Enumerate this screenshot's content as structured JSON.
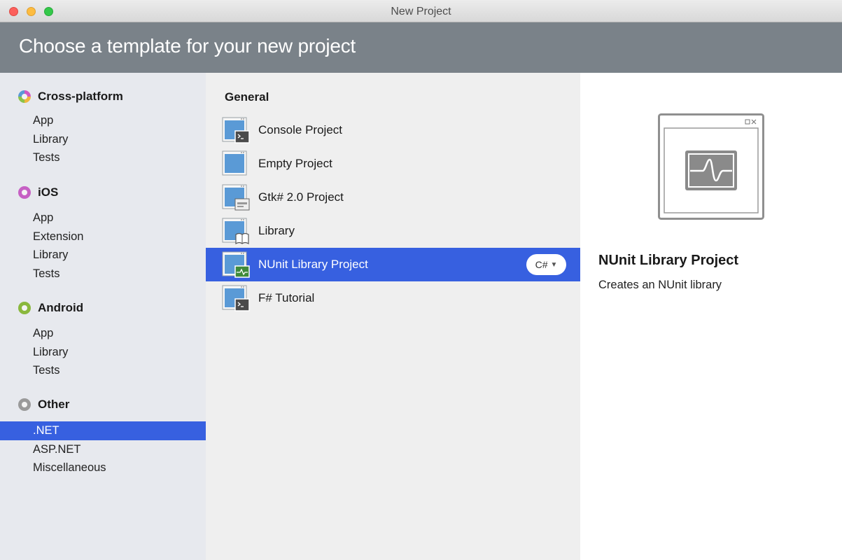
{
  "window": {
    "title": "New Project"
  },
  "header": {
    "title": "Choose a template for your new project"
  },
  "sidebar": {
    "categories": [
      {
        "label": "Cross-platform",
        "icon": "multicolor-circle-icon",
        "items": [
          "App",
          "Library",
          "Tests"
        ]
      },
      {
        "label": "iOS",
        "icon": "ios-circle-icon",
        "items": [
          "App",
          "Extension",
          "Library",
          "Tests"
        ]
      },
      {
        "label": "Android",
        "icon": "android-circle-icon",
        "items": [
          "App",
          "Library",
          "Tests"
        ]
      },
      {
        "label": "Other",
        "icon": "other-circle-icon",
        "items": [
          ".NET",
          "ASP.NET",
          "Miscellaneous"
        ]
      }
    ],
    "selected": ".NET"
  },
  "templates": {
    "section": "General",
    "items": [
      {
        "label": "Console Project",
        "icon": "console-project-icon"
      },
      {
        "label": "Empty Project",
        "icon": "empty-project-icon"
      },
      {
        "label": "Gtk# 2.0 Project",
        "icon": "gtk-project-icon"
      },
      {
        "label": "Library",
        "icon": "library-project-icon"
      },
      {
        "label": "NUnit Library Project",
        "icon": "nunit-project-icon"
      },
      {
        "label": "F# Tutorial",
        "icon": "fsharp-tutorial-icon"
      }
    ],
    "selected": "NUnit Library Project",
    "language": "C#"
  },
  "details": {
    "title": "NUnit Library Project",
    "description": "Creates an NUnit library"
  },
  "colors": {
    "selection": "#3760e0",
    "header_band": "#7a8289",
    "sidebar_bg": "#e7e9ee",
    "middle_bg": "#efefef"
  }
}
